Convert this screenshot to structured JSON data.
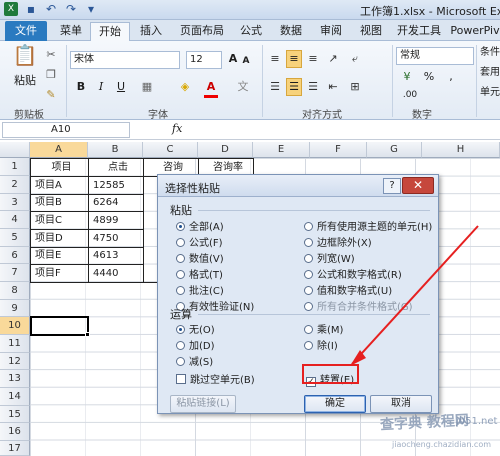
{
  "window": {
    "title": "工作簿1.xlsx - Microsoft Ex"
  },
  "tabs": [
    "文件",
    "菜单",
    "开始",
    "插入",
    "页面布局",
    "公式",
    "数据",
    "审阅",
    "视图",
    "开发工具",
    "PowerPiv"
  ],
  "active_tab": "开始",
  "ribbon": {
    "paste_label": "粘贴",
    "font_name": "宋体",
    "font_size": "12",
    "number_format": "常规",
    "groups": [
      "剪贴板",
      "字体",
      "对齐方式",
      "数字"
    ],
    "right_buttons": [
      "条件",
      "套用",
      "单元"
    ],
    "bold": "B",
    "italic": "I",
    "underline": "U",
    "font_color_a": "A",
    "percent": "%",
    "comma": ",",
    "currency": "¥",
    "inc_dec": ".00",
    "grow": "A",
    "shrink": "A"
  },
  "formula_bar": {
    "name_box": "A10",
    "fx": "fx"
  },
  "columns": [
    "A",
    "B",
    "C",
    "D",
    "E",
    "F",
    "G",
    "H"
  ],
  "rows": [
    "1",
    "2",
    "3",
    "4",
    "5",
    "6",
    "7",
    "8",
    "9",
    "10",
    "11",
    "12",
    "13",
    "14",
    "15",
    "16",
    "17"
  ],
  "sheet": {
    "header": [
      "项目",
      "点击",
      "咨询",
      "咨询率"
    ],
    "items": [
      {
        "name": "项目A",
        "clicks": "12585"
      },
      {
        "name": "项目B",
        "clicks": "6264"
      },
      {
        "name": "项目C",
        "clicks": "4899"
      },
      {
        "name": "项目D",
        "clicks": "4750"
      },
      {
        "name": "项目E",
        "clicks": "4613"
      },
      {
        "name": "项目F",
        "clicks": "4440"
      }
    ]
  },
  "dialog": {
    "title": "选择性粘贴",
    "help": "?",
    "close": "✕",
    "paste_section": "粘贴",
    "paste_left": [
      "全部(A)",
      "公式(F)",
      "数值(V)",
      "格式(T)",
      "批注(C)",
      "有效性验证(N)"
    ],
    "paste_right": [
      "所有使用源主题的单元(H)",
      "边框除外(X)",
      "列宽(W)",
      "公式和数字格式(R)",
      "值和数字格式(U)",
      "所有合并条件格式(G)"
    ],
    "op_section": "运算",
    "op_left": [
      "无(O)",
      "加(D)",
      "减(S)"
    ],
    "op_right": [
      "乘(M)",
      "除(I)"
    ],
    "skip_blanks": "跳过空单元(B)",
    "transpose": "转置(E)",
    "paste_link": "粘贴链接(L)",
    "ok": "确定",
    "cancel": "取消"
  },
  "watermark": {
    "line1": "查字典 教程网",
    "line2": "jiaocheng.chazidian.com",
    "line3": "jb51.net"
  }
}
